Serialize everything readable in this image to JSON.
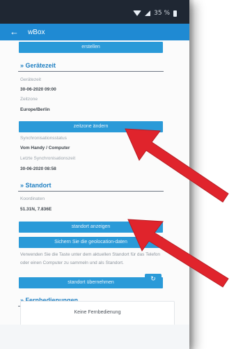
{
  "status": {
    "battery": "35 %"
  },
  "app": {
    "title": "wBox",
    "back_icon": "arrow-left-icon"
  },
  "top_button": {
    "label": "erstellen"
  },
  "geraetezeit": {
    "heading": "» Gerätezeit",
    "fields": [
      {
        "label": "Gerätezeit",
        "value": "30-06-2020 09:00"
      },
      {
        "label": "Zeitzone",
        "value": "Europe/Berlin"
      }
    ],
    "button": "zeitzone ändern",
    "sync_label": "Synchronisationsstatus",
    "sync_value": "Vom Handy / Computer",
    "sync_time_label": "Letzte Synchronisationszeit",
    "sync_time_value": "30-06-2020 08:58"
  },
  "standort": {
    "heading": "» Standort",
    "label": "Koordinaten",
    "value": "51.31N, 7.836E",
    "button_show": "standort anzeigen",
    "button_geo": "Sichern Sie die geolocation-daten",
    "note": "Verwenden Sie die Taste unter dem aktuellen Standort für das Telefon oder einen Computer zu sammeln und als Standort.",
    "button_adopt": "standort übernehmen"
  },
  "fernbedienungen": {
    "heading": "» Fernbedienungen",
    "refresh_icon": "refresh-icon",
    "empty": "Keine Fernbedienung"
  },
  "colors": {
    "app_bar": "#1f8ad3",
    "status_bar": "#1f2733",
    "button": "#2a9ad8",
    "accent_arrow": "#e0242c"
  }
}
